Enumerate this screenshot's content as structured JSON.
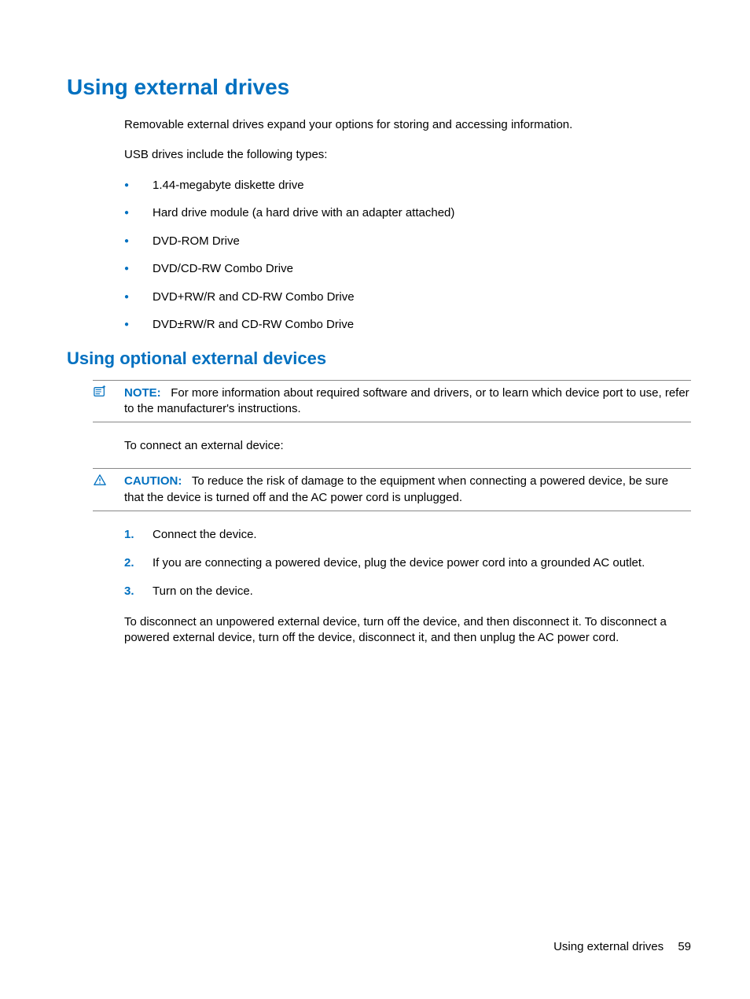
{
  "heading1": "Using external drives",
  "intro_p1": "Removable external drives expand your options for storing and accessing information.",
  "intro_p2": "USB drives include the following types:",
  "bullets": [
    "1.44-megabyte diskette drive",
    "Hard drive module (a hard drive with an adapter attached)",
    "DVD-ROM Drive",
    "DVD/CD-RW Combo Drive",
    "DVD+RW/R and CD-RW Combo Drive",
    "DVD±RW/R and CD-RW Combo Drive"
  ],
  "heading2": "Using optional external devices",
  "note": {
    "label": "NOTE:",
    "text": "For more information about required software and drivers, or to learn which device port to use, refer to the manufacturer's instructions."
  },
  "connect_intro": "To connect an external device:",
  "caution": {
    "label": "CAUTION:",
    "text": "To reduce the risk of damage to the equipment when connecting a powered device, be sure that the device is turned off and the AC power cord is unplugged."
  },
  "steps": [
    {
      "num": "1.",
      "text": "Connect the device."
    },
    {
      "num": "2.",
      "text": "If you are connecting a powered device, plug the device power cord into a grounded AC outlet."
    },
    {
      "num": "3.",
      "text": "Turn on the device."
    }
  ],
  "disconnect_para": "To disconnect an unpowered external device, turn off the device, and then disconnect it. To disconnect a powered external device, turn off the device, disconnect it, and then unplug the AC power cord.",
  "footer": {
    "section": "Using external drives",
    "page": "59"
  }
}
